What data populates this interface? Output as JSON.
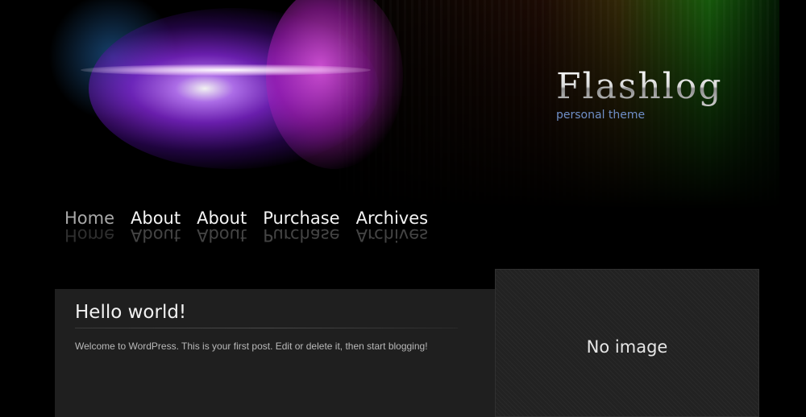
{
  "site": {
    "title": "Flashlog",
    "tagline": "personal theme"
  },
  "nav": {
    "items": [
      {
        "label": "Home",
        "active": true
      },
      {
        "label": "About",
        "active": false
      },
      {
        "label": "About",
        "active": false
      },
      {
        "label": "Purchase",
        "active": false
      },
      {
        "label": "Archives",
        "active": false
      }
    ]
  },
  "post": {
    "title": "Hello world!",
    "excerpt": "Welcome to WordPress. This is your first post. Edit or delete it, then start blogging!"
  },
  "feature": {
    "placeholder": "No image"
  },
  "colors": {
    "background": "#000000",
    "panel": "#1f1f1f",
    "tagline": "#6f8fc8",
    "accent_purple": "#8c28e6"
  }
}
